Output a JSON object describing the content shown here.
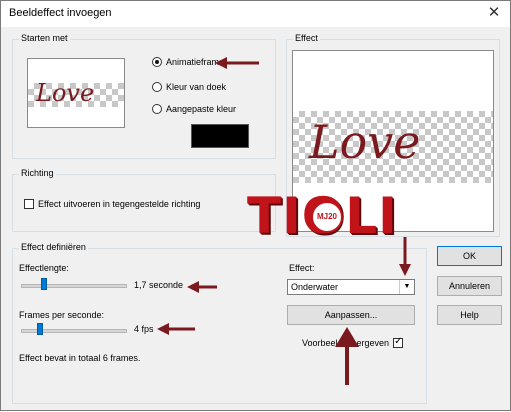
{
  "window": {
    "title": "Beeldeffect invoegen",
    "close_glyph": "✕"
  },
  "start_group": {
    "label": "Starten met",
    "preview_text": "Love",
    "options": [
      {
        "label": "Animatieframe",
        "selected": true
      },
      {
        "label": "Kleur van doek",
        "selected": false
      },
      {
        "label": "Aangepaste kleur",
        "selected": false
      }
    ],
    "custom_color": "#000000"
  },
  "effect_group": {
    "label": "Effect",
    "preview_text": "Love"
  },
  "direction_group": {
    "label": "Richting",
    "reverse_label": "Effect uitvoeren in tegengestelde richting",
    "reverse_checked": false
  },
  "define_group": {
    "label": "Effect definiëren",
    "length_label": "Effectlengte:",
    "length_value": "1,7 seconde",
    "fps_label": "Frames per seconde:",
    "fps_value": "4 fps",
    "summary": "Effect bevat in totaal 6 frames.",
    "effect_label": "Effect:",
    "effect_selected": "Onderwater",
    "customize_label": "Aanpassen...",
    "preview_label": "Voorbeeld weergeven",
    "preview_checked": true
  },
  "buttons": {
    "ok": "OK",
    "cancel": "Annuleren",
    "help": "Help"
  },
  "watermark": {
    "text": "TIOLI",
    "badge": "MJ20"
  },
  "colors": {
    "accent": "#0078d7",
    "arrow": "#7a1a1e",
    "watermark": "#c0141a"
  }
}
